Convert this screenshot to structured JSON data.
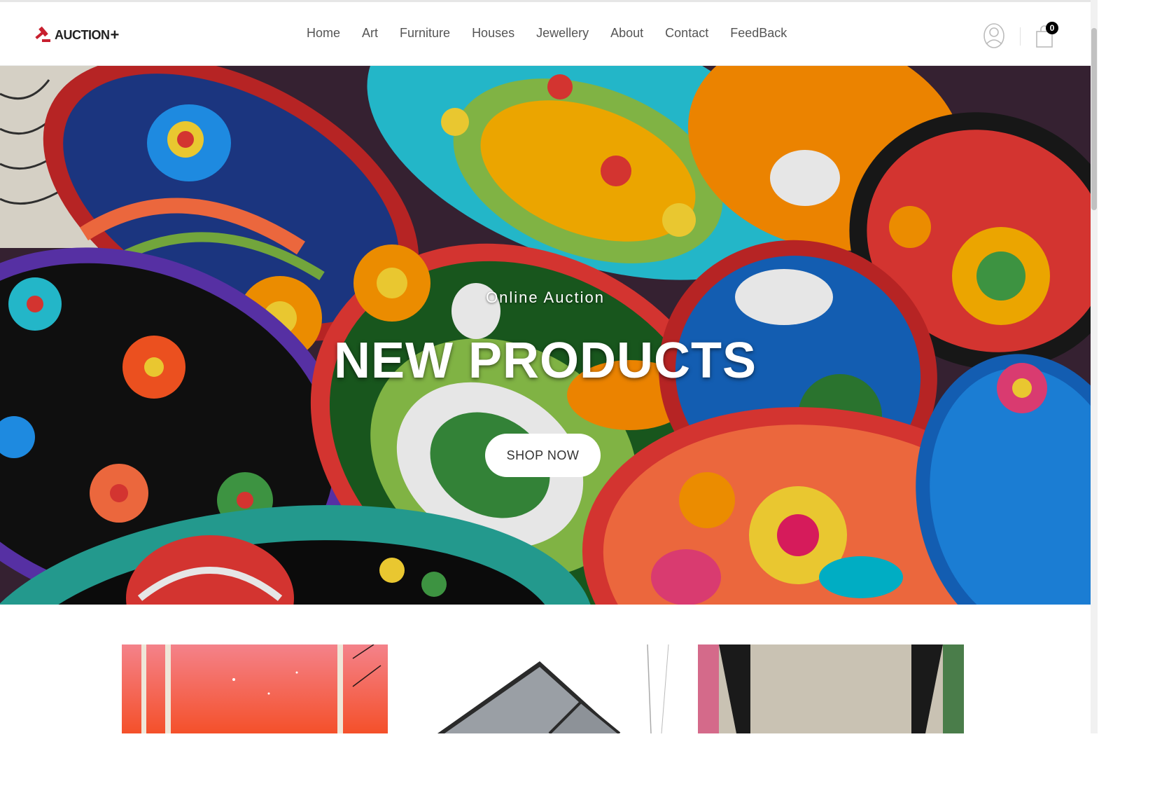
{
  "brand": {
    "name": "AUCTION",
    "plus": "+"
  },
  "nav": {
    "items": [
      "Home",
      "Art",
      "Furniture",
      "Houses",
      "Jewellery",
      "About",
      "Contact",
      "FeedBack"
    ]
  },
  "header": {
    "user_icon": "user-icon",
    "cart_icon": "shopping-bag-icon",
    "cart_count": "0"
  },
  "hero": {
    "subtitle": "Online Auction",
    "title": "NEW PRODUCTS",
    "button_label": "SHOP NOW"
  },
  "cards": [
    {
      "name": "art-painting-card",
      "image": "sunset-trees-painting"
    },
    {
      "name": "house-card",
      "image": "grey-house"
    },
    {
      "name": "furniture-card",
      "image": "chair-interior"
    }
  ],
  "colors": {
    "brand_red": "#c8202f",
    "nav_text": "#555555",
    "hero_text": "#ffffff"
  }
}
